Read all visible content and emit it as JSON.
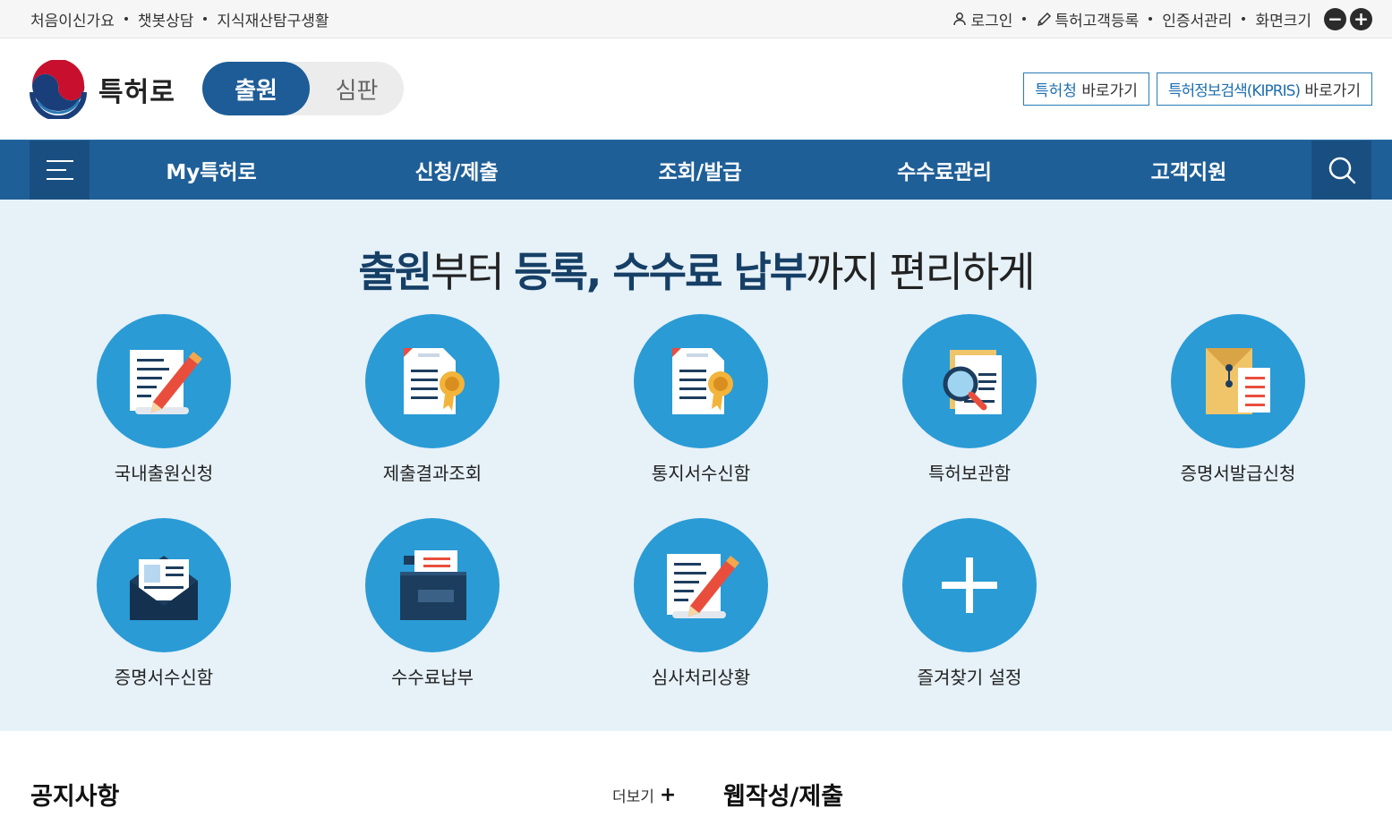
{
  "util": {
    "left_links": [
      "처음이신가요",
      "챗봇상담",
      "지식재산탐구생활"
    ],
    "login": "로그인",
    "register": "특허고객등록",
    "cert": "인증서관리",
    "zoom_label": "화면크기",
    "zoom_out": "−",
    "zoom_in": "+"
  },
  "header": {
    "logo_text": "특허로",
    "toggle_on": "출원",
    "toggle_off": "심판",
    "ext1_hl": "특허청",
    "ext1_rest": " 바로가기",
    "ext2_hl": "특허정보검색(KIPRIS)",
    "ext2_rest": " 바로가기"
  },
  "nav": {
    "items": [
      "My특허로",
      "신청/제출",
      "조회/발급",
      "수수료관리",
      "고객지원"
    ]
  },
  "hero": {
    "t1": "출원",
    "t2": "부터 ",
    "t3": "등록, 수수료 납부",
    "t4": "까지 편리하게"
  },
  "quick": [
    {
      "label": "국내출원신청",
      "icon": "document-pencil-icon"
    },
    {
      "label": "제출결과조회",
      "icon": "certificate-document-icon"
    },
    {
      "label": "통지서수신함",
      "icon": "notice-document-icon"
    },
    {
      "label": "특허보관함",
      "icon": "magnifier-document-icon"
    },
    {
      "label": "증명서발급신청",
      "icon": "envelope-document-icon"
    },
    {
      "label": "증명서수신함",
      "icon": "mail-open-icon"
    },
    {
      "label": "수수료납부",
      "icon": "folder-icon"
    },
    {
      "label": "심사처리상황",
      "icon": "document-pencil-icon"
    },
    {
      "label": "즐겨찾기 설정",
      "icon": "plus-icon"
    }
  ],
  "bottom": {
    "notice_title": "공지사항",
    "more": "더보기",
    "more_plus": "+",
    "web_title": "웹작성/제출"
  }
}
